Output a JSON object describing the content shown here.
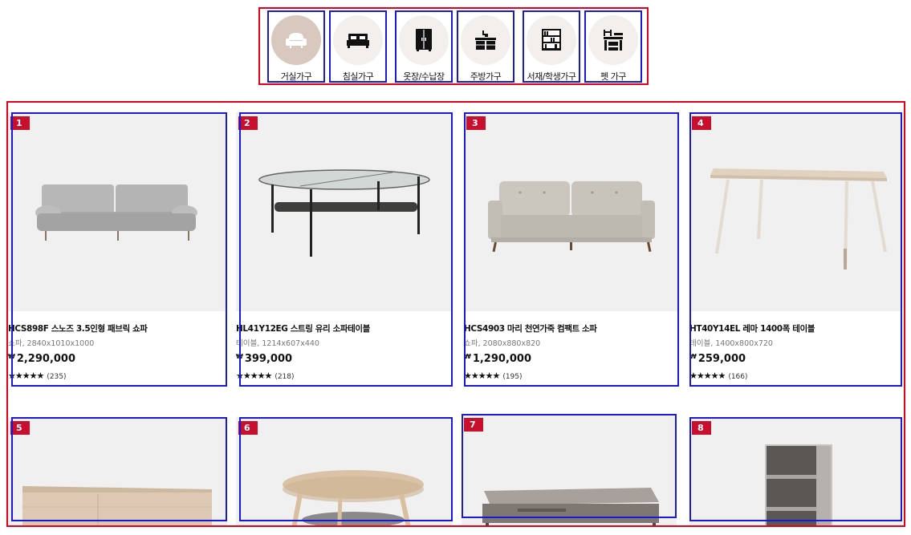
{
  "categories": [
    {
      "label": "거실가구",
      "icon": "sofa-chair-icon"
    },
    {
      "label": "침실가구",
      "icon": "bed-icon"
    },
    {
      "label": "옷장/수납장",
      "icon": "wardrobe-icon"
    },
    {
      "label": "주방가구",
      "icon": "kitchen-icon"
    },
    {
      "label": "서재/학생가구",
      "icon": "bookshelf-icon"
    },
    {
      "label": "펫 가구",
      "icon": "pet-furniture-icon"
    }
  ],
  "products": [
    {
      "rank": "1",
      "name": "HCS898F 스노즈 3.5인형 패브릭 쇼파",
      "spec": "쇼파, 2840x1010x1000",
      "currency": "₩",
      "price": "2,290,000",
      "stars": "★★★★★",
      "reviews": "(235)",
      "image": "grey-fabric-sofa"
    },
    {
      "rank": "2",
      "name": "HL41Y12EG 스트링 유리 소파테이블",
      "spec": "테이블, 1214x607x440",
      "currency": "₩",
      "price": "399,000",
      "stars": "★★★★★",
      "reviews": "(218)",
      "image": "glass-coffee-table"
    },
    {
      "rank": "3",
      "name": "HCS4903 마리 천연가죽 컴팩트 소파",
      "spec": "쇼파, 2080x880x820",
      "currency": "₩",
      "price": "1,290,000",
      "stars": "★★★★★",
      "reviews": "(195)",
      "image": "leather-sofa"
    },
    {
      "rank": "4",
      "name": "HT40Y14EL 레마 1400폭 테이블",
      "spec": "테이블, 1400x800x720",
      "currency": "₩",
      "price": "259,000",
      "stars": "★★★★★",
      "reviews": "(166)",
      "image": "wood-table"
    },
    {
      "rank": "5",
      "image": "wood-sideboard"
    },
    {
      "rank": "6",
      "image": "round-side-table"
    },
    {
      "rank": "7",
      "image": "grey-coffee-table"
    },
    {
      "rank": "8",
      "image": "bookshelf"
    }
  ]
}
